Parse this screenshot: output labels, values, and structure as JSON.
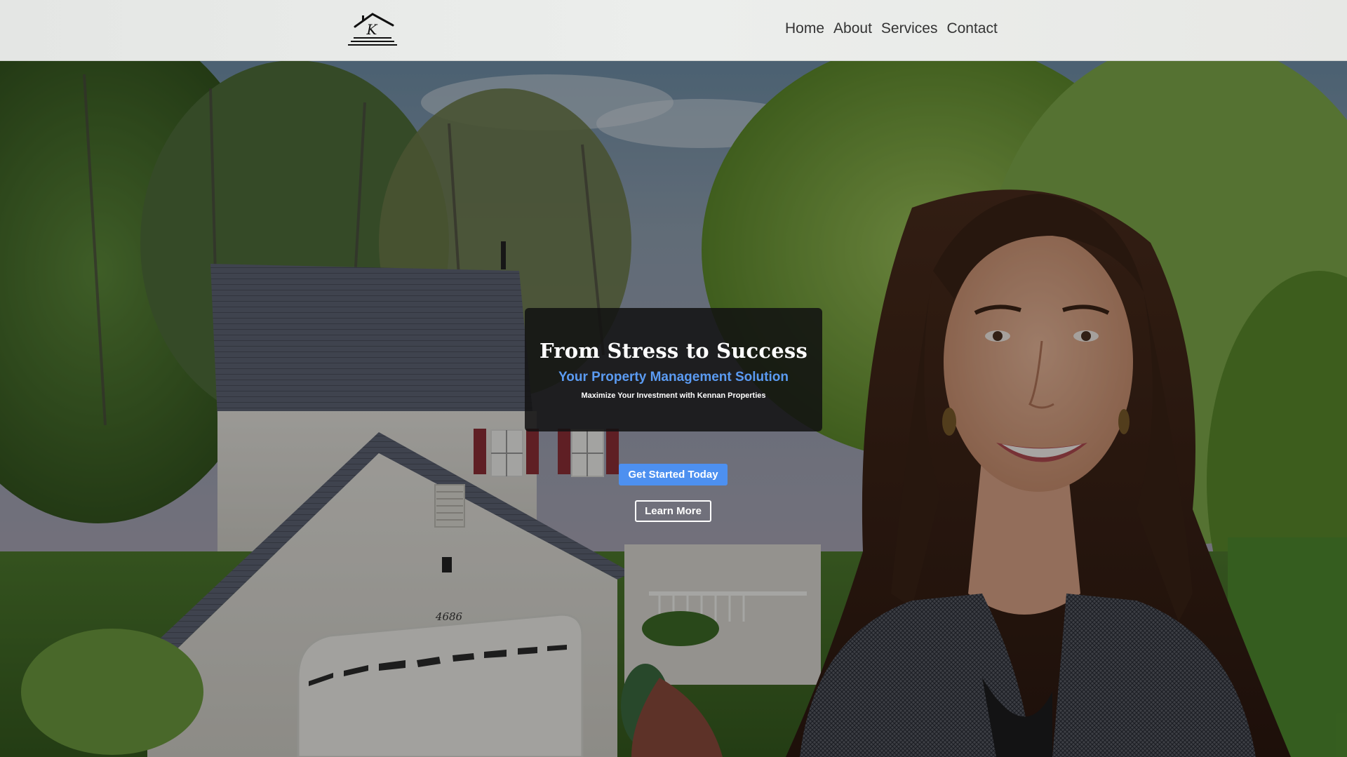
{
  "header": {
    "logo_alt": "Kennan Properties",
    "logo_letter": "K",
    "nav": [
      {
        "label": "Home"
      },
      {
        "label": "About"
      },
      {
        "label": "Services"
      },
      {
        "label": "Contact"
      }
    ]
  },
  "hero": {
    "title": "From Stress to Success",
    "subtitle": "Your Property Management Solution",
    "tagline": "Maximize Your Investment with Kennan Properties",
    "primary_cta": "Get Started Today",
    "secondary_cta": "Learn More",
    "house_number": "4686"
  },
  "colors": {
    "accent": "#4d90f0",
    "subtitle": "#5b9bf2",
    "header_bg": "#eceeec",
    "nav_text": "#333333"
  }
}
